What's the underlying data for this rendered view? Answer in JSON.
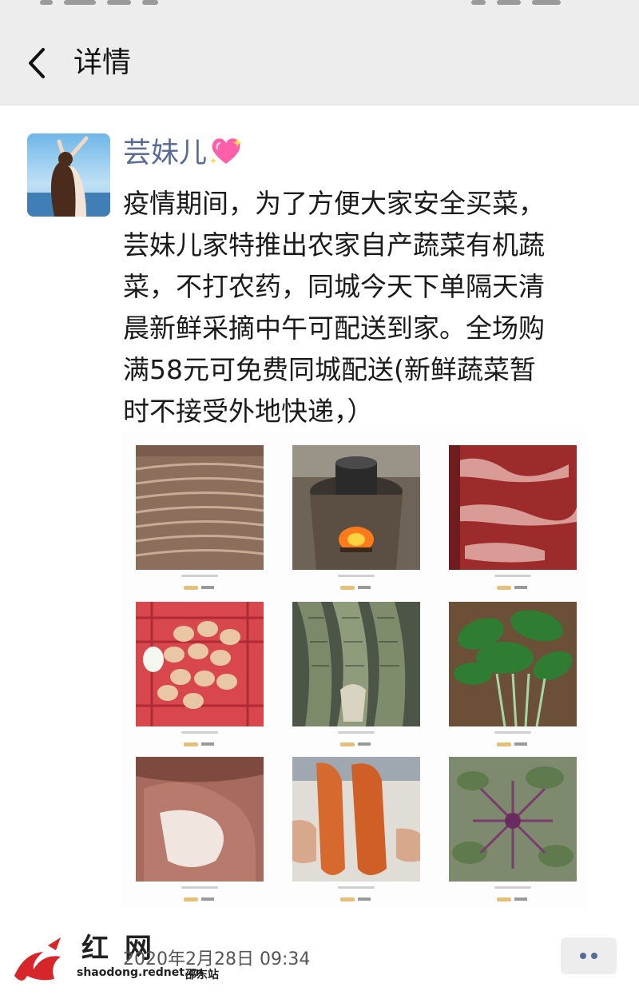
{
  "nav": {
    "title": "详情"
  },
  "post": {
    "author": "芸妹儿",
    "text_lines": [
      "疫情期间，为了方便大家安全买菜，",
      "芸妹儿家特推出农家自产蔬菜有机蔬",
      "菜，不打农药，同城今天下单隔天清",
      "晨新鲜采摘中午可配送到家。全场购",
      "满58元可免费同城配送(新鲜蔬菜暂",
      "时不接受外地快递，）"
    ],
    "timestamp": "2020年2月28日 09:34"
  },
  "gallery": [
    {
      "icon": "flatbread-image"
    },
    {
      "icon": "stove-pot-image"
    },
    {
      "icon": "cured-meat-image"
    },
    {
      "icon": "eggs-basket-image"
    },
    {
      "icon": "fish-image"
    },
    {
      "icon": "leafy-greens-image"
    },
    {
      "icon": "pork-image"
    },
    {
      "icon": "sweet-potato-image"
    },
    {
      "icon": "purple-greens-image"
    }
  ],
  "watermark": {
    "logo_text": "红网",
    "domain": "shaodong.rednet.cn",
    "station": "邵东站"
  },
  "colors": {
    "nav_bg": "#ededed",
    "author": "#576b95",
    "text": "#1a1a1a",
    "watermark_red": "#d6262a"
  }
}
